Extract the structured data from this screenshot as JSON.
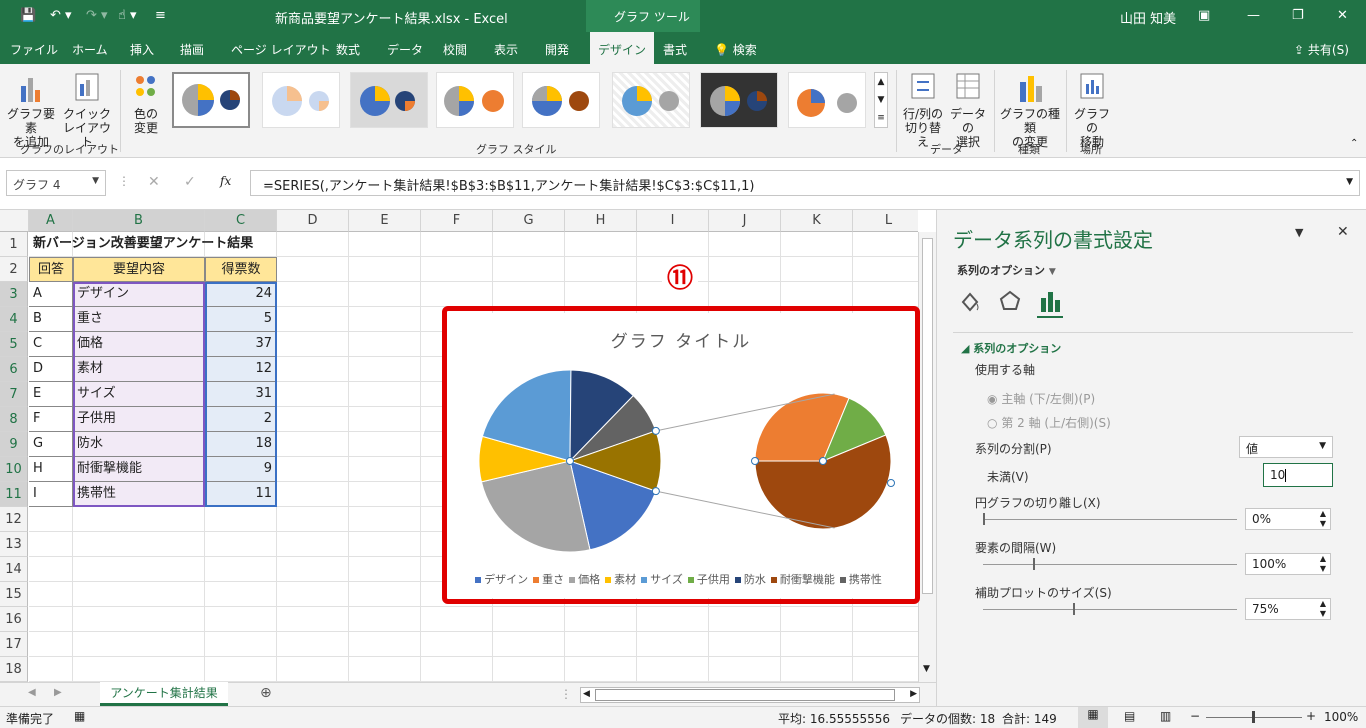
{
  "titlebar": {
    "filename": "新商品要望アンケート結果.xlsx  -  Excel",
    "context": "グラフ ツール",
    "user": "山田 知美"
  },
  "tabs": [
    "ファイル",
    "ホーム",
    "挿入",
    "描画",
    "ページ レイアウト",
    "数式",
    "データ",
    "校閲",
    "表示",
    "開発",
    "デザイン",
    "書式"
  ],
  "tabs_search": "検索",
  "share": "共有(S)",
  "ribbon": {
    "add_element": [
      "グラフ要素",
      "を追加"
    ],
    "quick_layout": [
      "クイック",
      "レイアウト"
    ],
    "change_color": [
      "色の",
      "変更"
    ],
    "group_layout": "グラフのレイアウト",
    "group_styles": "グラフ スタイル",
    "switch_rowcol": [
      "行/列の",
      "切り替え"
    ],
    "select_data": [
      "データの",
      "選択"
    ],
    "group_data": "データ",
    "change_type": [
      "グラフの種類",
      "の変更"
    ],
    "group_type": "種類",
    "move_chart": [
      "グラフの",
      "移動"
    ],
    "group_location": "場所"
  },
  "formula_bar": {
    "name_box": "グラフ 4",
    "fx": "fx",
    "formula": "=SERIES(,アンケート集計結果!$B$3:$B$11,アンケート集計結果!$C$3:$C$11,1)"
  },
  "columns": [
    "A",
    "B",
    "C",
    "D",
    "E",
    "F",
    "G",
    "H",
    "I",
    "J",
    "K",
    "L"
  ],
  "rows": [
    "1",
    "2",
    "3",
    "4",
    "5",
    "6",
    "7",
    "8",
    "9",
    "10",
    "11",
    "12",
    "13",
    "14",
    "15",
    "16",
    "17",
    "18"
  ],
  "sheet": {
    "title": "新バージョン改善要望アンケート結果",
    "headers": [
      "回答",
      "要望内容",
      "得票数"
    ],
    "data": [
      [
        "A",
        "デザイン",
        "24"
      ],
      [
        "B",
        "重さ",
        "5"
      ],
      [
        "C",
        "価格",
        "37"
      ],
      [
        "D",
        "素材",
        "12"
      ],
      [
        "E",
        "サイズ",
        "31"
      ],
      [
        "F",
        "子供用",
        "2"
      ],
      [
        "G",
        "防水",
        "18"
      ],
      [
        "H",
        "耐衝撃機能",
        "9"
      ],
      [
        "I",
        "携帯性",
        "11"
      ]
    ]
  },
  "chart": {
    "title": "グラフ タイトル",
    "marker": "⑪",
    "legend": [
      {
        "label": "デザイン",
        "color": "#4472c4"
      },
      {
        "label": "重さ",
        "color": "#ed7d31"
      },
      {
        "label": "価格",
        "color": "#a5a5a5"
      },
      {
        "label": "素材",
        "color": "#ffc000"
      },
      {
        "label": "サイズ",
        "color": "#5b9bd5"
      },
      {
        "label": "子供用",
        "color": "#70ad47"
      },
      {
        "label": "防水",
        "color": "#264478"
      },
      {
        "label": "耐衝撃機能",
        "color": "#9e480e"
      },
      {
        "label": "携帯性",
        "color": "#636363"
      }
    ],
    "highlight_color": "#e00000"
  },
  "chart_data": {
    "type": "pie",
    "subtype": "pie-of-pie",
    "title": "グラフ タイトル",
    "categories": [
      "デザイン",
      "重さ",
      "価格",
      "素材",
      "サイズ",
      "子供用",
      "防水",
      "耐衝撃機能",
      "携帯性"
    ],
    "values": [
      24,
      5,
      37,
      12,
      31,
      2,
      18,
      9,
      11
    ],
    "secondary_plot": [
      "重さ",
      "子供用",
      "耐衝撃機能"
    ],
    "split_by": "値",
    "split_threshold": 10,
    "legend_position": "bottom"
  },
  "panel": {
    "title": "データ系列の書式設定",
    "options_dropdown": "系列のオプション",
    "section": "系列のオプション",
    "axis_label": "使用する軸",
    "primary_axis": "主軸 (下/左側)(P)",
    "secondary_axis": "第 2 軸 (上/右側)(S)",
    "split_label": "系列の分割(P)",
    "split_value": "値",
    "below_label": "未満(V)",
    "below_value": "10",
    "explosion_label": "円グラフの切り離し(X)",
    "explosion_value": "0%",
    "gap_label": "要素の間隔(W)",
    "gap_value": "100%",
    "size_label": "補助プロットのサイズ(S)",
    "size_value": "75%"
  },
  "sheet_tab": "アンケート集計結果",
  "status": {
    "ready": "準備完了",
    "average": "平均: 16.55555556",
    "count": "データの個数: 18",
    "sum": "合計: 149",
    "zoom": "100%"
  }
}
